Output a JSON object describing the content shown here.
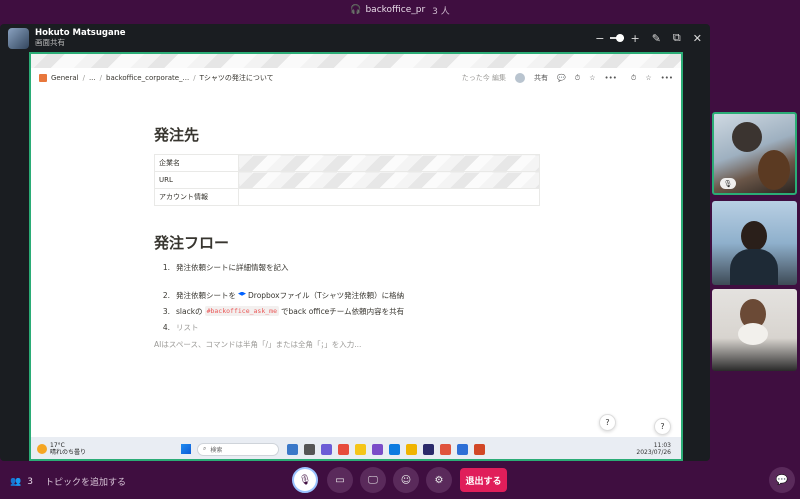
{
  "huddle": {
    "channel": "backoffice_pr",
    "count": "3 人"
  },
  "presenter": {
    "name": "Hokuto Matsugane",
    "status": "画面共有"
  },
  "window_controls": {
    "minus": "−",
    "plus": "+",
    "close": "✕"
  },
  "notion": {
    "breadcrumbs": [
      "General",
      "...",
      "backoffice_corporate_...",
      "Tシャツの発注について"
    ],
    "edited": "たった今 編集",
    "share": "共有",
    "more": "•••"
  },
  "doc": {
    "heading1": "発注先",
    "table": [
      {
        "key": "企業名",
        "value": ""
      },
      {
        "key": "URL",
        "value": ""
      },
      {
        "key": "アカウント情報",
        "value": ""
      }
    ],
    "heading2": "発注フロー",
    "steps": {
      "s1": {
        "num": "1.",
        "text": "発注依頼シートに詳細情報を記入"
      },
      "s2": {
        "num": "2.",
        "before": "発注依頼シートを",
        "after": "Dropboxファイル（Tシャツ発注依頼）に格納"
      },
      "s3": {
        "num": "3.",
        "before": "slackの",
        "code": "#backoffice_ask_me",
        "after": "でback officeチーム依頼内容を共有"
      },
      "s4": {
        "num": "4.",
        "text": "リスト"
      }
    },
    "ai_placeholder": "AIはスペース、コマンドは半角「/」または全角「；」を入力..."
  },
  "help": "?",
  "taskbar": {
    "temp": "17°C",
    "weather": "晴れのち曇り",
    "search": "検索",
    "time": "11:03",
    "date": "2023/07/26"
  },
  "bottom": {
    "participants": "3",
    "topic": "トピックを追加する",
    "leave": "退出する"
  },
  "colors": {
    "bg": "#3f0e40",
    "active_border": "#2bac76",
    "leave": "#e01e5a"
  }
}
